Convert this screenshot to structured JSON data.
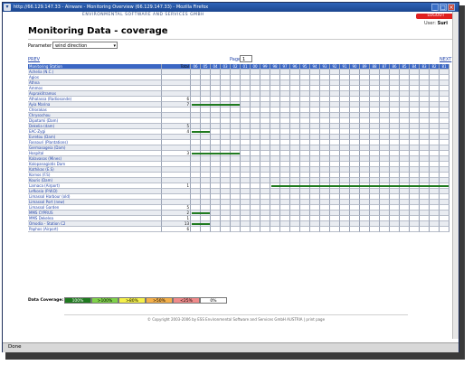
{
  "window": {
    "title": "http://66.129.147.33 - Airware - Monitoring Overview (66.129.147.33) - Mozilla Firefox",
    "buttons": [
      "_",
      "□",
      "×"
    ]
  },
  "header": {
    "company": "ENVIRONMENTAL SOFTWARE AND SERVICES GMBH",
    "logout_label": "LOGOUT",
    "user_label": "User:",
    "user_name": "Suri",
    "page_title": "Monitoring Data - coverage"
  },
  "controls": {
    "parameter_label": "Parameter",
    "parameter_value": "wind direction",
    "prev_label": "PREV",
    "next_label": "NEXT",
    "page_label": "Page",
    "page_value": "1"
  },
  "table": {
    "station_header": "Monitoring Station",
    "total_header": "Total",
    "year_headers": [
      "06",
      "05",
      "04",
      "03",
      "02",
      "01",
      "00",
      "99",
      "98",
      "97",
      "96",
      "95",
      "94",
      "93",
      "92",
      "91",
      "90",
      "89",
      "88",
      "87",
      "86",
      "85",
      "84",
      "83",
      "82",
      "81"
    ],
    "rows": [
      {
        "name": "Achelia (N.C.)",
        "total": "",
        "bar": null
      },
      {
        "name": "Agios",
        "total": "",
        "bar": null
      },
      {
        "name": "Athna",
        "total": "",
        "bar": null
      },
      {
        "name": "Ammos",
        "total": "",
        "bar": null
      },
      {
        "name": "Aspraklitramos",
        "total": "",
        "bar": null
      },
      {
        "name": "Athalassa (Radiosonde)",
        "total": "6",
        "bar": null
      },
      {
        "name": "Ayia Marina",
        "total": "7",
        "bar": [
          1,
          5
        ]
      },
      {
        "name": "Chlorakas",
        "total": "",
        "bar": null
      },
      {
        "name": "Chrysochou",
        "total": "",
        "bar": null
      },
      {
        "name": "Dipotami (Dam)",
        "total": "",
        "bar": null
      },
      {
        "name": "Dekelia (dam)",
        "total": "5",
        "bar": null
      },
      {
        "name": "EAC-Zygi",
        "total": "4",
        "bar": [
          1,
          2
        ]
      },
      {
        "name": "Evretou (Dam)",
        "total": "",
        "bar": null
      },
      {
        "name": "Fassouri (Plantations)",
        "total": "",
        "bar": null
      },
      {
        "name": "Germasogeia (Dam)",
        "total": "",
        "bar": null
      },
      {
        "name": "Hospital",
        "total": "3",
        "bar": [
          1,
          5
        ]
      },
      {
        "name": "Kalavasos (Mines)",
        "total": "",
        "bar": null
      },
      {
        "name": "Kalopanagiotis Dam",
        "total": "",
        "bar": null
      },
      {
        "name": "Kathikas (E.S)",
        "total": "",
        "bar": null
      },
      {
        "name": "Kornos (F.S)",
        "total": "",
        "bar": null
      },
      {
        "name": "Kouris (Dam)",
        "total": "",
        "bar": null
      },
      {
        "name": "Larnaca (Airport)",
        "total": "1",
        "bar": [
          9,
          26
        ]
      },
      {
        "name": "Lefkosia (P.W.D)",
        "total": "",
        "bar": null
      },
      {
        "name": "Limassol Harbour (old)",
        "total": "",
        "bar": null
      },
      {
        "name": "Limassol Port (new)",
        "total": "",
        "bar": null
      },
      {
        "name": "Limassol Garden",
        "total": "5",
        "bar": null
      },
      {
        "name": "MMS CYPRUS",
        "total": "2",
        "bar": [
          1,
          2
        ]
      },
      {
        "name": "MMS Dekelea",
        "total": "1",
        "bar": null
      },
      {
        "name": "Omodia - Station C2",
        "total": "13",
        "bar": [
          1,
          2
        ]
      },
      {
        "name": "Paphos (Airport)",
        "total": "6",
        "bar": null
      }
    ]
  },
  "legend": {
    "label": "Data Coverage:",
    "items": [
      {
        "text": "100%",
        "color": "#1f7a1f"
      },
      {
        "text": ">100%",
        "color": "#7fd24a"
      },
      {
        "text": ">80%",
        "color": "#f5f04a"
      },
      {
        "text": ">50%",
        "color": "#f5b04a"
      },
      {
        "text": "<25%",
        "color": "#f08a8a"
      },
      {
        "text": "0%",
        "color": "#ffffff"
      }
    ]
  },
  "footer": {
    "text": "© Copyright 2003-2006 by ESS Environmental Software and Services GmbH AUSTRIA | print page"
  },
  "status": {
    "text": "Done"
  }
}
